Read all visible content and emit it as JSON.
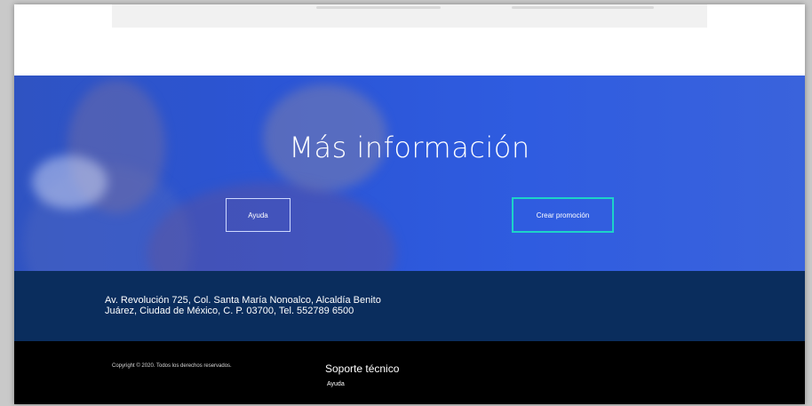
{
  "hero": {
    "title": "Más información",
    "buttons": {
      "help_label": "Ayuda",
      "create_promo_label": "Crear promoción"
    }
  },
  "address": {
    "line1": "Av. Revolución 725, Col. Santa María Nonoalco, Alcaldía Benito",
    "line2": "Juárez, Ciudad de México, C. P. 03700, Tel. 552789 6500"
  },
  "footer": {
    "copyright": "Copyright © 2020. Todos los derechos reservados.",
    "support_title": "Soporte técnico",
    "support_link": "Ayuda"
  },
  "colors": {
    "hero_blue": "#2b55d6",
    "address_band": "#0a2d5d",
    "footer_bg": "#000000",
    "promo_border": "#1dd3c8"
  }
}
